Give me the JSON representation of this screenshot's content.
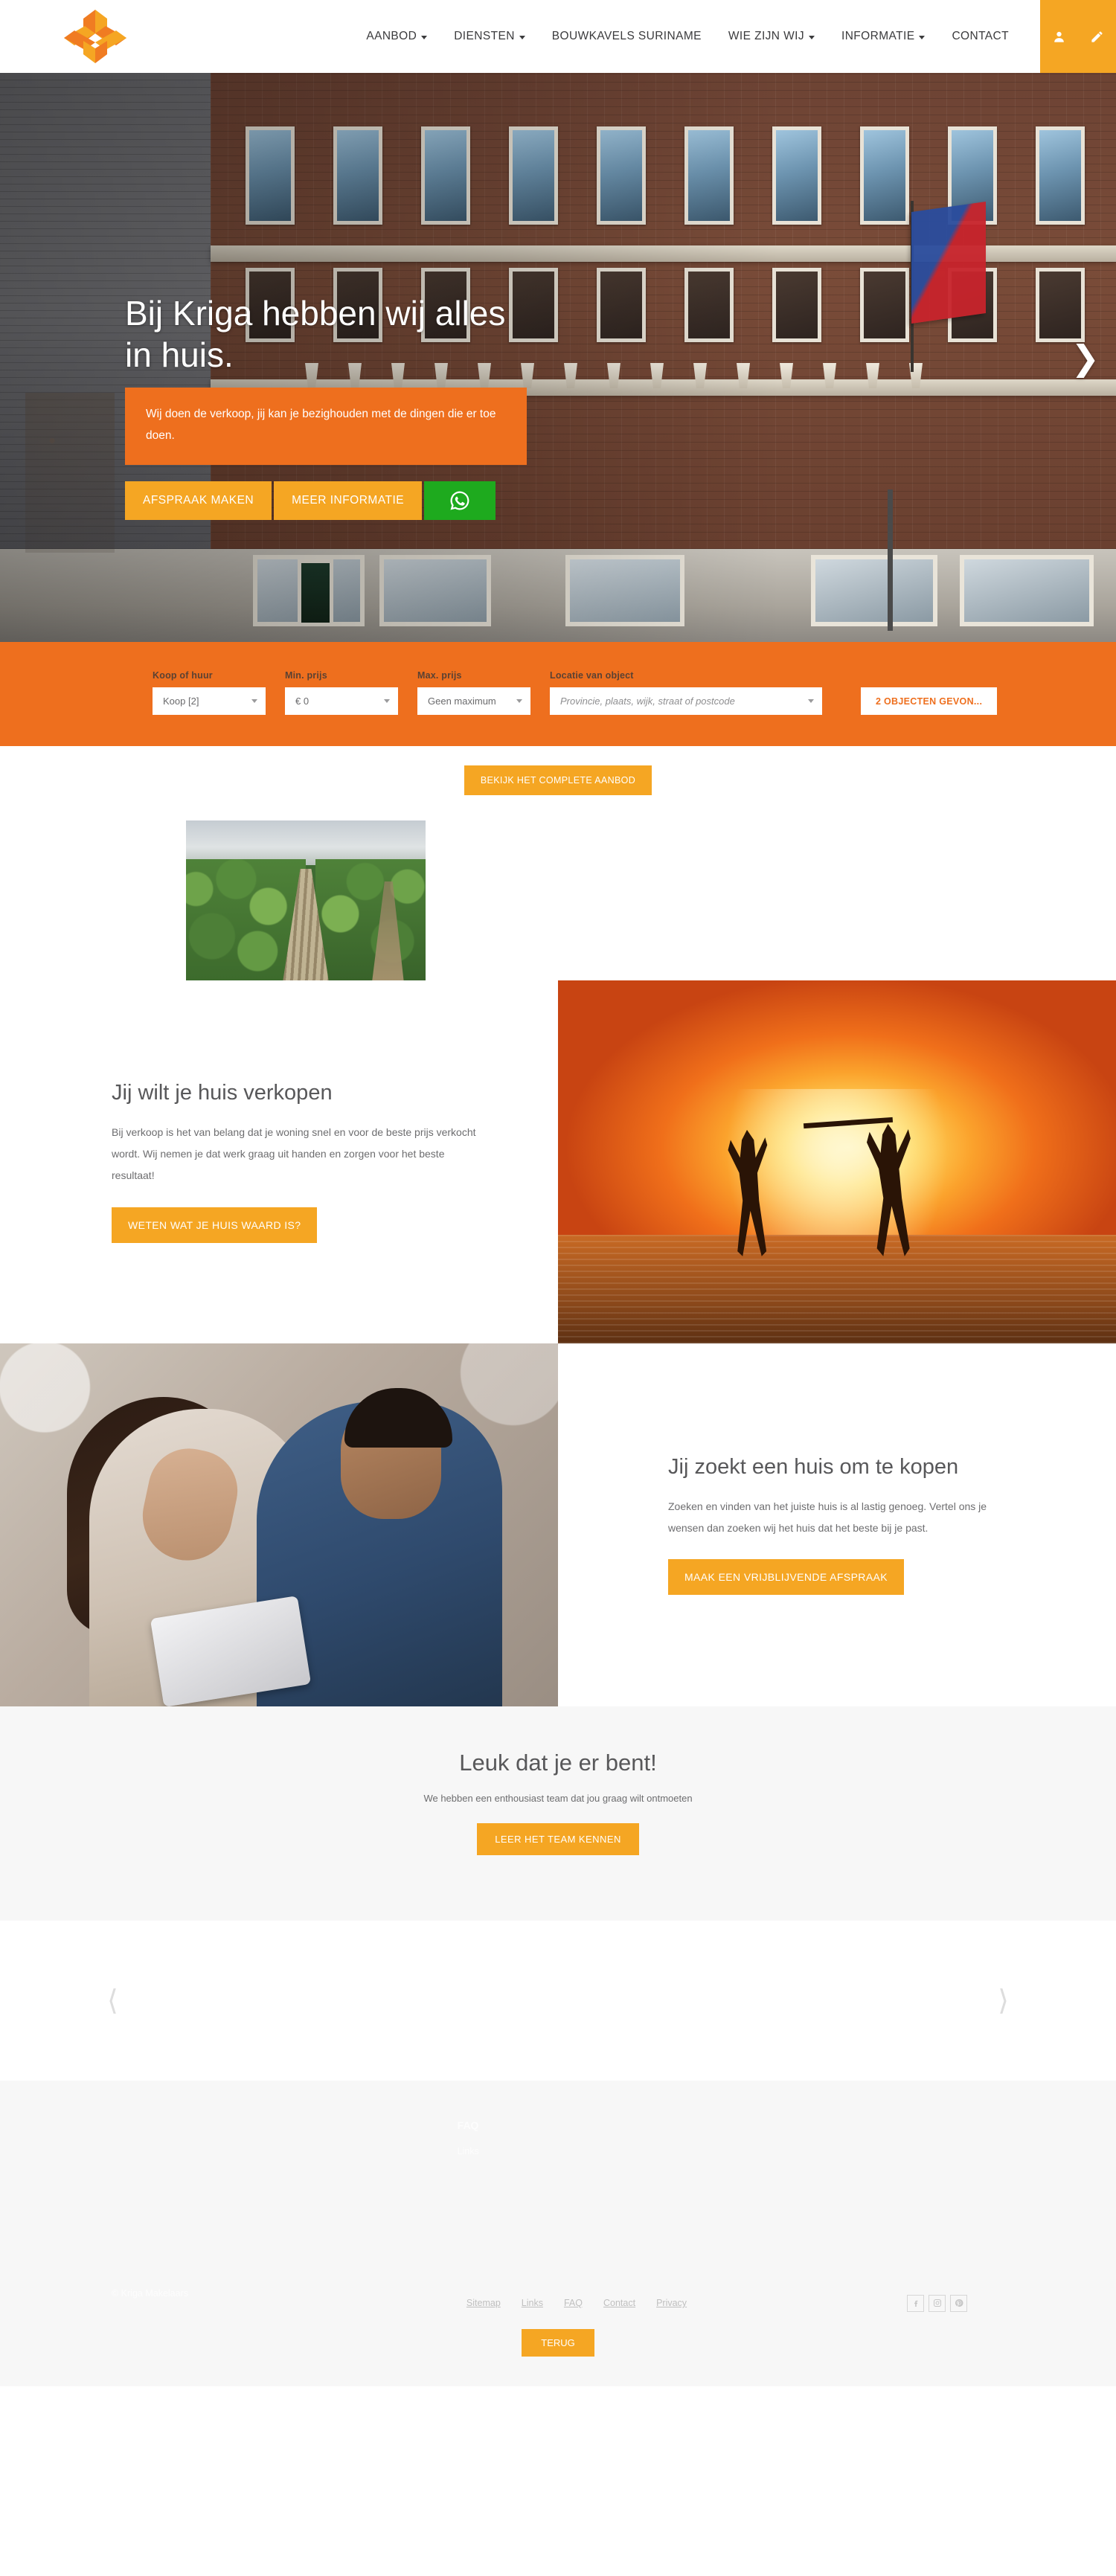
{
  "brand": {
    "name": "Kriga Makelaars",
    "logo_icon": "kriga-three-chevron-star-logo",
    "accent_orange": "#ee6f1e",
    "accent_amber": "#f5a623",
    "whatsapp_green": "#1eaa1e"
  },
  "header": {
    "nav": [
      {
        "label": "AANBOD",
        "has_dropdown": true
      },
      {
        "label": "DIENSTEN",
        "has_dropdown": true
      },
      {
        "label": "BOUWKAVELS SURINAME",
        "has_dropdown": false
      },
      {
        "label": "WIE ZIJN WIJ",
        "has_dropdown": true
      },
      {
        "label": "INFORMATIE",
        "has_dropdown": true
      },
      {
        "label": "CONTACT",
        "has_dropdown": false
      }
    ],
    "actions": [
      {
        "icon": "user-account-icon"
      },
      {
        "icon": "pencil-edit-icon"
      }
    ]
  },
  "hero": {
    "title": "Bij Kriga hebben wij alles in huis.",
    "subtitle": "Wij doen de verkoop, jij kan je bezighouden met de dingen die er toe doen.",
    "buttons": [
      {
        "label": "AFSPRAAK MAKEN"
      },
      {
        "label": "MEER INFORMATIE"
      }
    ],
    "whatsapp_icon": "whatsapp-icon",
    "next_arrow_icon": "chevron-right-icon",
    "background_alt": "Historisch bakstenen pand met Surinaamse vlag"
  },
  "search": {
    "fields": [
      {
        "label": "Koop of huur",
        "value": "Koop [2]",
        "type": "select"
      },
      {
        "label": "Min. prijs",
        "value": "€ 0",
        "type": "select"
      },
      {
        "label": "Max. prijs",
        "value": "Geen maximum",
        "type": "select"
      },
      {
        "label": "Locatie van object",
        "placeholder": "Provincie, plaats, wijk, straat of postcode",
        "type": "select-search"
      }
    ],
    "results_button": "2 OBJECTEN GEVON..."
  },
  "offer": {
    "cta_label": "BEKIJK HET COMPLETE AANBOD",
    "cards": [
      {
        "image_alt": "Luchtfoto van ontwikkelde bouwkavels in het groen"
      }
    ]
  },
  "sell_section": {
    "title": "Jij wilt je huis verkopen",
    "body": "Bij verkoop is het van belang dat je woning snel en voor de beste prijs verkocht wordt. Wij nemen je dat werk graag uit handen en zorgen voor het beste resultaat!",
    "button": "WETEN WAT JE HUIS WAARD IS?",
    "image_alt": "Silhouet van springend koppel op het strand bij zonsondergang"
  },
  "buy_section": {
    "title": "Jij zoekt een huis om te kopen",
    "body": "Zoeken en vinden van het juiste huis is al lastig genoeg. Vertel ons je wensen dan zoeken wij het huis dat het beste bij je past.",
    "button": "MAAK EEN VRIJBLIJVENDE AFSPRAAK",
    "image_alt": "Koppel kijkt samen naar een tablet"
  },
  "team": {
    "title": "Leuk dat je er bent!",
    "subtitle": "We hebben een enthousiast team dat jou graag wilt ontmoeten",
    "button": "LEER HET TEAM KENNEN"
  },
  "carousel": {
    "prev_icon": "chevron-left-icon",
    "next_icon": "chevron-right-icon"
  },
  "footer": {
    "columns": [
      {
        "title": "",
        "links": []
      },
      {
        "title": "FAQ",
        "links": [
          "Links"
        ]
      },
      {
        "title": "",
        "links": []
      }
    ],
    "copyright": "© Kriga Makelaars",
    "links": [
      "Sitemap",
      "Links",
      "FAQ",
      "Contact",
      "Privacy"
    ],
    "socials": [
      {
        "icon": "facebook-icon"
      },
      {
        "icon": "instagram-icon"
      },
      {
        "icon": "pinterest-icon"
      }
    ],
    "back_button": "TERUG"
  }
}
